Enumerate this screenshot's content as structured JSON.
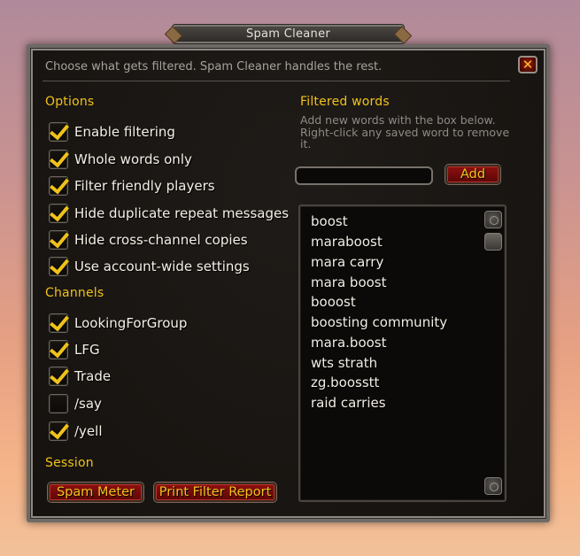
{
  "window": {
    "title": "Spam Cleaner",
    "subtitle": "Choose what gets filtered. Spam Cleaner handles the rest.",
    "close_label": "✕"
  },
  "options": {
    "heading": "Options",
    "items": [
      {
        "label": "Enable filtering",
        "checked": true
      },
      {
        "label": "Whole words only",
        "checked": true
      },
      {
        "label": "Filter friendly players",
        "checked": true
      },
      {
        "label": "Hide duplicate repeat messages",
        "checked": true
      },
      {
        "label": "Hide cross-channel copies",
        "checked": true
      },
      {
        "label": "Use account-wide settings",
        "checked": true
      }
    ]
  },
  "channels": {
    "heading": "Channels",
    "items": [
      {
        "label": "LookingForGroup",
        "checked": true
      },
      {
        "label": "LFG",
        "checked": true
      },
      {
        "label": "Trade",
        "checked": true
      },
      {
        "label": "/say",
        "checked": false
      },
      {
        "label": "/yell",
        "checked": true
      }
    ]
  },
  "session": {
    "heading": "Session",
    "spam_meter_label": "Spam Meter",
    "report_label": "Print Filter Report"
  },
  "filtered_words": {
    "heading": "Filtered words",
    "hint": "Add new words with the box below. Right-click any saved word to remove it.",
    "input_value": "",
    "add_label": "Add",
    "words": [
      "boost",
      "maraboost",
      "mara carry",
      "mara boost",
      "booost",
      "boosting community",
      "mara.boost",
      "wts strath",
      "zg.boosstt",
      "raid carries"
    ]
  },
  "colors": {
    "gold": "#f1c21a",
    "button_red": "#8f1010",
    "panel_bg": "#1b1713"
  }
}
